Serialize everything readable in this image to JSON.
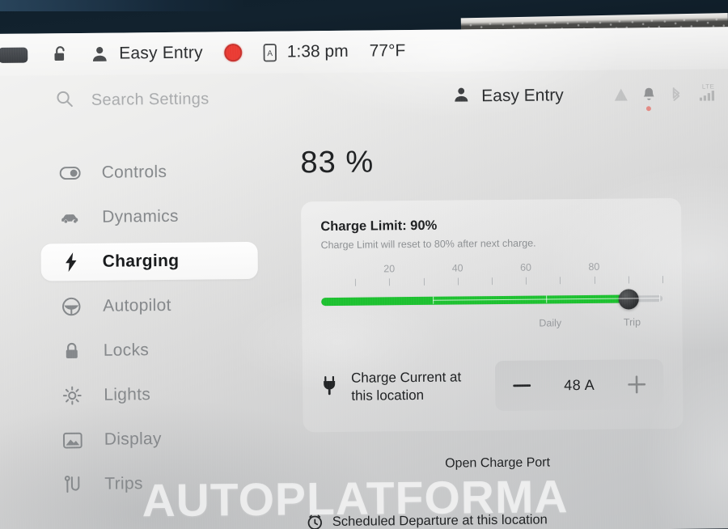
{
  "status_bar": {
    "lock_icon": "unlocked-padlock-icon",
    "profile_icon": "person-icon",
    "profile_label": "Easy Entry",
    "record_icon": "dashcam-record-icon",
    "phone_key_icon": "phone-key-icon",
    "time": "1:38 pm",
    "temperature": "77°F",
    "car_button_icon": "car-quick-control-icon"
  },
  "search": {
    "icon": "search-icon",
    "placeholder": "Search Settings"
  },
  "header_right": {
    "profile_icon": "person-icon",
    "profile_label": "Easy Entry",
    "car_icon": "car-status-icon",
    "bell_icon": "bell-notification-icon",
    "bluetooth_icon": "bluetooth-icon",
    "network_label": "LTE",
    "signal_icon": "signal-bars-icon"
  },
  "sidebar": {
    "items": [
      {
        "label": "Controls",
        "icon": "toggle-switch-icon",
        "active": false
      },
      {
        "label": "Dynamics",
        "icon": "car-side-icon",
        "active": false
      },
      {
        "label": "Charging",
        "icon": "lightning-bolt-icon",
        "active": true
      },
      {
        "label": "Autopilot",
        "icon": "steering-wheel-icon",
        "active": false
      },
      {
        "label": "Locks",
        "icon": "padlock-icon",
        "active": false
      },
      {
        "label": "Lights",
        "icon": "brightness-sun-icon",
        "active": false
      },
      {
        "label": "Display",
        "icon": "display-image-icon",
        "active": false
      },
      {
        "label": "Trips",
        "icon": "route-trips-icon",
        "active": false
      }
    ]
  },
  "charging": {
    "state_of_charge": "83 %",
    "charge_limit_title": "Charge Limit: 90%",
    "charge_limit_note": "Charge Limit will reset to 80% after next charge.",
    "slider": {
      "value": 90,
      "min": 0,
      "max": 100,
      "tick_labels": [
        "20",
        "40",
        "60",
        "80"
      ],
      "tick_label_values": [
        20,
        40,
        60,
        80
      ],
      "tick_values": [
        10,
        20,
        30,
        40,
        50,
        60,
        70,
        80,
        90,
        100
      ],
      "mode_labels": [
        {
          "label": "Daily",
          "value": 67
        },
        {
          "label": "Trip",
          "value": 91
        }
      ],
      "fill_color": "#1dc130",
      "thumb_color": "#2d2f31"
    },
    "charge_current": {
      "icon": "charge-plug-icon",
      "label": "Charge Current at this location",
      "label_line1": "Charge Current at",
      "label_line2": "this location",
      "value": "48 A",
      "decrease_label": "—",
      "increase_label": "+"
    },
    "open_charge_port": "Open Charge Port",
    "scheduled_departure": {
      "icon": "alarm-clock-icon",
      "label": "Scheduled Departure at this location"
    }
  },
  "watermark": {
    "text": "AUTOPLATFORMA"
  }
}
